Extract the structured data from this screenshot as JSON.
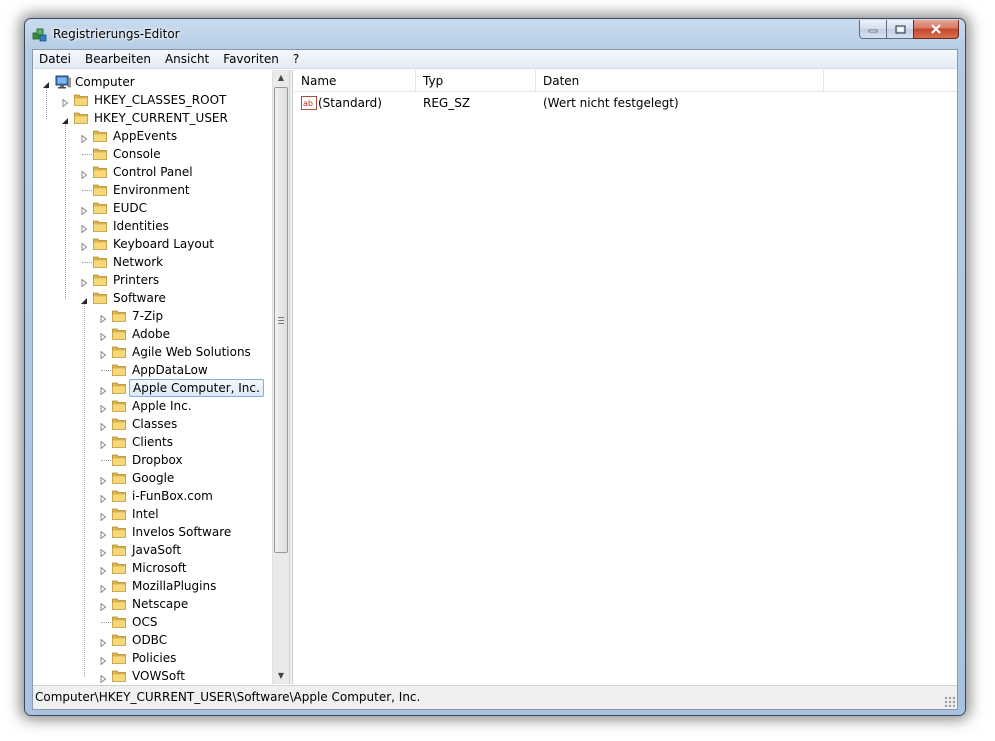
{
  "window": {
    "title": "Registrierungs-Editor"
  },
  "menu": [
    "Datei",
    "Bearbeiten",
    "Ansicht",
    "Favoriten",
    "?"
  ],
  "tree": [
    {
      "label": "Computer",
      "level": 0,
      "state": "open",
      "icon": "computer-icon"
    },
    {
      "label": "HKEY_CLASSES_ROOT",
      "level": 1,
      "state": "closed",
      "icon": "folder-icon"
    },
    {
      "label": "HKEY_CURRENT_USER",
      "level": 1,
      "state": "open",
      "icon": "folder-icon"
    },
    {
      "label": "AppEvents",
      "level": 2,
      "state": "closed",
      "icon": "folder-icon"
    },
    {
      "label": "Console",
      "level": 2,
      "state": "leaf",
      "icon": "folder-icon"
    },
    {
      "label": "Control Panel",
      "level": 2,
      "state": "closed",
      "icon": "folder-icon"
    },
    {
      "label": "Environment",
      "level": 2,
      "state": "leaf",
      "icon": "folder-icon"
    },
    {
      "label": "EUDC",
      "level": 2,
      "state": "closed",
      "icon": "folder-icon"
    },
    {
      "label": "Identities",
      "level": 2,
      "state": "closed",
      "icon": "folder-icon"
    },
    {
      "label": "Keyboard Layout",
      "level": 2,
      "state": "closed",
      "icon": "folder-icon"
    },
    {
      "label": "Network",
      "level": 2,
      "state": "leaf",
      "icon": "folder-icon"
    },
    {
      "label": "Printers",
      "level": 2,
      "state": "closed",
      "icon": "folder-icon"
    },
    {
      "label": "Software",
      "level": 2,
      "state": "open",
      "icon": "folder-icon"
    },
    {
      "label": "7-Zip",
      "level": 3,
      "state": "closed",
      "icon": "folder-icon"
    },
    {
      "label": "Adobe",
      "level": 3,
      "state": "closed",
      "icon": "folder-icon"
    },
    {
      "label": "Agile Web Solutions",
      "level": 3,
      "state": "closed",
      "icon": "folder-icon"
    },
    {
      "label": "AppDataLow",
      "level": 3,
      "state": "leaf",
      "icon": "folder-icon"
    },
    {
      "label": "Apple Computer, Inc.",
      "level": 3,
      "state": "closed",
      "icon": "folder-icon",
      "selected": true
    },
    {
      "label": "Apple Inc.",
      "level": 3,
      "state": "closed",
      "icon": "folder-icon"
    },
    {
      "label": "Classes",
      "level": 3,
      "state": "closed",
      "icon": "folder-icon"
    },
    {
      "label": "Clients",
      "level": 3,
      "state": "closed",
      "icon": "folder-icon"
    },
    {
      "label": "Dropbox",
      "level": 3,
      "state": "leaf",
      "icon": "folder-icon"
    },
    {
      "label": "Google",
      "level": 3,
      "state": "closed",
      "icon": "folder-icon"
    },
    {
      "label": "i-FunBox.com",
      "level": 3,
      "state": "closed",
      "icon": "folder-icon"
    },
    {
      "label": "Intel",
      "level": 3,
      "state": "closed",
      "icon": "folder-icon"
    },
    {
      "label": "Invelos Software",
      "level": 3,
      "state": "closed",
      "icon": "folder-icon"
    },
    {
      "label": "JavaSoft",
      "level": 3,
      "state": "closed",
      "icon": "folder-icon"
    },
    {
      "label": "Microsoft",
      "level": 3,
      "state": "closed",
      "icon": "folder-icon"
    },
    {
      "label": "MozillaPlugins",
      "level": 3,
      "state": "closed",
      "icon": "folder-icon"
    },
    {
      "label": "Netscape",
      "level": 3,
      "state": "closed",
      "icon": "folder-icon"
    },
    {
      "label": "OCS",
      "level": 3,
      "state": "leaf",
      "icon": "folder-icon"
    },
    {
      "label": "ODBC",
      "level": 3,
      "state": "closed",
      "icon": "folder-icon"
    },
    {
      "label": "Policies",
      "level": 3,
      "state": "closed",
      "icon": "folder-icon"
    },
    {
      "label": "VOWSoft",
      "level": 3,
      "state": "closed",
      "icon": "folder-icon"
    }
  ],
  "list": {
    "columns": [
      "Name",
      "Typ",
      "Daten"
    ],
    "rows": [
      {
        "name": "(Standard)",
        "type": "REG_SZ",
        "data": "(Wert nicht festgelegt)",
        "icon": "string-value-icon"
      }
    ]
  },
  "status": {
    "path": "Computer\\HKEY_CURRENT_USER\\Software\\Apple Computer, Inc."
  },
  "colors": {
    "selection_border": "#84acdd",
    "folder": "#e8c25a",
    "titlebar": "#b7cde6"
  }
}
